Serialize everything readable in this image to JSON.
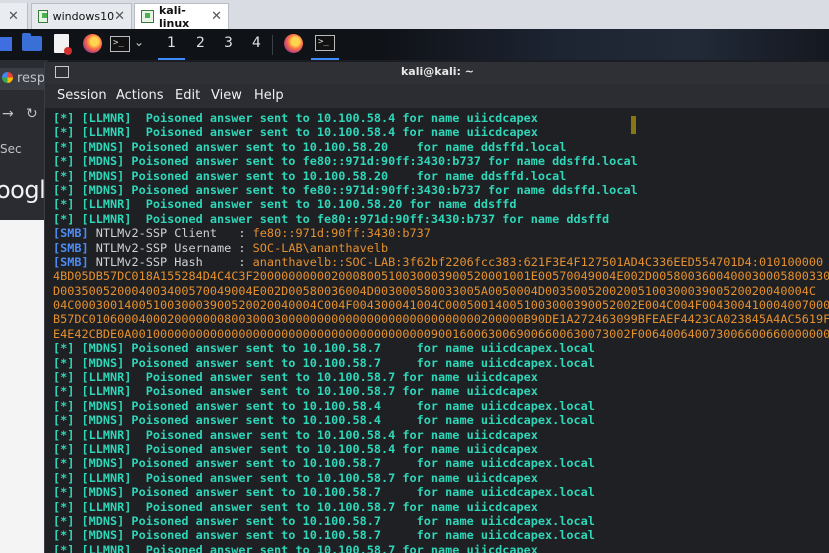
{
  "vm_tabs": {
    "left_close": "✕",
    "tabs": [
      {
        "label": "windows10",
        "close": "✕"
      },
      {
        "label": "kali-linux",
        "close": "✕"
      }
    ]
  },
  "panel": {
    "term_glyph": ">_",
    "chevron": "⌄",
    "workspaces": [
      "1",
      "2",
      "3",
      "4"
    ]
  },
  "bg_browser": {
    "tab_text": "resp",
    "nav_back": "→",
    "nav_reload": "↻",
    "address_text": "Sec",
    "logo_text": "oogle"
  },
  "terminal": {
    "title": "kali@kali: ~",
    "menu": [
      "Session",
      "Actions",
      "Edit",
      "View",
      "Help"
    ],
    "lines": [
      [
        [
          "[*] [LLMNR]  Poisoned answer sent to 10.100.58.4 for name uiicdcapex",
          "cyan"
        ]
      ],
      [
        [
          "[*] [LLMNR]  Poisoned answer sent to 10.100.58.4 for name uiicdcapex",
          "cyan"
        ]
      ],
      [
        [
          "[*] [MDNS] Poisoned answer sent to 10.100.58.20    for name ddsffd.local",
          "cyan"
        ]
      ],
      [
        [
          "[*] [MDNS] Poisoned answer sent to fe80::971d:90ff:3430:b737 for name ddsffd.local",
          "cyan"
        ]
      ],
      [
        [
          "[*] [MDNS] Poisoned answer sent to 10.100.58.20    for name ddsffd.local",
          "cyan"
        ]
      ],
      [
        [
          "[*] [MDNS] Poisoned answer sent to fe80::971d:90ff:3430:b737 for name ddsffd.local",
          "cyan"
        ]
      ],
      [
        [
          "[*] [LLMNR]  Poisoned answer sent to 10.100.58.20 for name ddsffd",
          "cyan"
        ]
      ],
      [
        [
          "[*] [LLMNR]  Poisoned answer sent to fe80::971d:90ff:3430:b737 for name ddsffd",
          "cyan"
        ]
      ],
      [
        [
          "[SMB]",
          "blue"
        ],
        [
          " NTLMv2-SSP Client   : ",
          "white"
        ],
        [
          "fe80::971d:90ff:3430:b737",
          "orange"
        ]
      ],
      [
        [
          "[SMB]",
          "blue"
        ],
        [
          " NTLMv2-SSP Username : ",
          "white"
        ],
        [
          "SOC-LAB\\ananthavelb",
          "orange"
        ]
      ],
      [
        [
          "[SMB]",
          "blue"
        ],
        [
          " NTLMv2-SSP Hash     : ",
          "white"
        ],
        [
          "ananthavelb::SOC-LAB:3f62bf2206fcc383:621F3E4F127501AD4C336EED554701D4:010100000",
          "orange"
        ]
      ],
      [
        [
          "4BD05DB57DC018A155284D4C4C3F200000000002000800510030003900520001001E00570049004E002D0058003600400030005800330",
          "orange"
        ]
      ],
      [
        [
          "D003500520004003400570049004E002D00580036004D003000580033005A0050004D0035005200200510030003900520020040004C",
          "orange"
        ]
      ],
      [
        [
          "04C0003001400510030003900520020040004C004F004300041004C000500140051003000390052002E004C004F0043004100040070008",
          "orange"
        ]
      ],
      [
        [
          "B57DC0106000400020000000800300030000000000000000000000000000200000B90DE1A272463099BFEAEF4423CA023845A4AC5619F55",
          "orange"
        ]
      ],
      [
        [
          "E4E42CBDE0A0010000000000000000000000000000000000000009001600630069006600630073002F00640064007300660066000000000",
          "orange"
        ]
      ],
      [
        [
          "[*] [MDNS] Poisoned answer sent to 10.100.58.7     for name uiicdcapex.local",
          "cyan"
        ]
      ],
      [
        [
          "[*] [MDNS] Poisoned answer sent to 10.100.58.7     for name uiicdcapex.local",
          "cyan"
        ]
      ],
      [
        [
          "[*] [LLMNR]  Poisoned answer sent to 10.100.58.7 for name uiicdcapex",
          "cyan"
        ]
      ],
      [
        [
          "[*] [LLMNR]  Poisoned answer sent to 10.100.58.7 for name uiicdcapex",
          "cyan"
        ]
      ],
      [
        [
          "[*] [MDNS] Poisoned answer sent to 10.100.58.4     for name uiicdcapex.local",
          "cyan"
        ]
      ],
      [
        [
          "[*] [MDNS] Poisoned answer sent to 10.100.58.4     for name uiicdcapex.local",
          "cyan"
        ]
      ],
      [
        [
          "[*] [LLMNR]  Poisoned answer sent to 10.100.58.4 for name uiicdcapex",
          "cyan"
        ]
      ],
      [
        [
          "[*] [LLMNR]  Poisoned answer sent to 10.100.58.4 for name uiicdcapex",
          "cyan"
        ]
      ],
      [
        [
          "[*] [MDNS] Poisoned answer sent to 10.100.58.7     for name uiicdcapex.local",
          "cyan"
        ]
      ],
      [
        [
          "[*] [LLMNR]  Poisoned answer sent to 10.100.58.7 for name uiicdcapex",
          "cyan"
        ]
      ],
      [
        [
          "[*] [MDNS] Poisoned answer sent to 10.100.58.7     for name uiicdcapex.local",
          "cyan"
        ]
      ],
      [
        [
          "[*] [LLMNR]  Poisoned answer sent to 10.100.58.7 for name uiicdcapex",
          "cyan"
        ]
      ],
      [
        [
          "[*] [MDNS] Poisoned answer sent to 10.100.58.7     for name uiicdcapex.local",
          "cyan"
        ]
      ],
      [
        [
          "[*] [MDNS] Poisoned answer sent to 10.100.58.7     for name uiicdcapex.local",
          "cyan"
        ]
      ],
      [
        [
          "[*] [LLMNR]  Poisoned answer sent to 10.100.58.7 for name uiicdcapex",
          "cyan"
        ]
      ]
    ]
  }
}
